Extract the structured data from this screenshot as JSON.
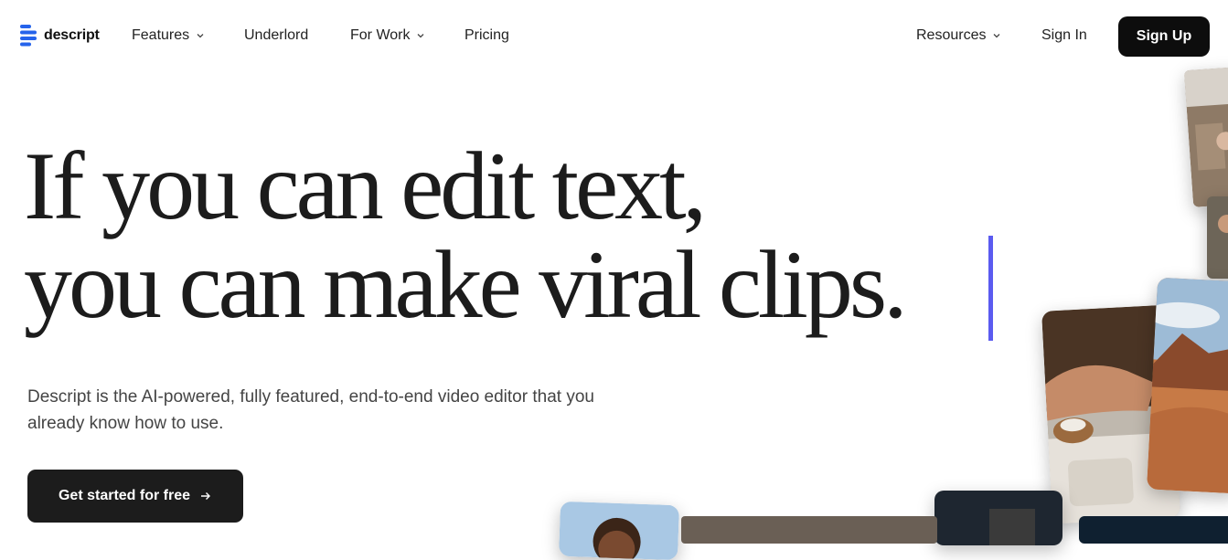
{
  "brand": {
    "name": "descript",
    "accent": "#2563eb"
  },
  "nav": {
    "items": [
      {
        "label": "Features",
        "dropdown": true
      },
      {
        "label": "Underlord",
        "dropdown": false
      },
      {
        "label": "For Work",
        "dropdown": true
      },
      {
        "label": "Pricing",
        "dropdown": false
      }
    ],
    "resources": "Resources",
    "sign_in": "Sign In",
    "sign_up": "Sign Up"
  },
  "hero": {
    "headline_line1": "If you can edit text,",
    "headline_line2": "you can make viral clips.",
    "subtext": "Descript is the AI-powered, fully featured, end-to-end video editor that you already know how to use.",
    "cta_label": "Get started for free",
    "cta_icon": "arrow-right-icon",
    "caret_color": "#5b5bf0"
  }
}
